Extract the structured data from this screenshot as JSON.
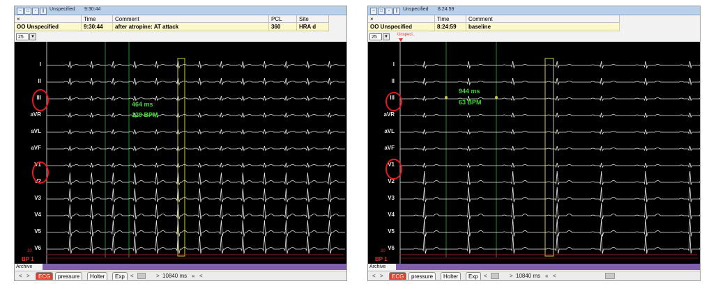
{
  "colors": {
    "ecg_trace": "#e8e8e8",
    "grid_green": "#2a8a2a",
    "yellow_box": "#cfcf4a",
    "circle": "#e01b1b",
    "bp_red": "#cc2a2a",
    "purple": "#7f5fae"
  },
  "panels": [
    {
      "title_time": "9:30:44",
      "title_label": "Unspecified",
      "columns": {
        "time": "Time",
        "comment": "Comment",
        "pcl": "PCL",
        "site": "Site",
        "close": "×"
      },
      "row": {
        "name": "OO Unspecified",
        "time": "9:30:44",
        "comment": "after atropine: AT attack",
        "pcl": "360",
        "site": "HRA d"
      },
      "zoom": "25",
      "measure_ms": "464 ms",
      "measure_bpm": "129 BPM",
      "leads": [
        "I",
        "II",
        "III",
        "aVR",
        "aVL",
        "aVF",
        "V1",
        "V2",
        "V3",
        "V4",
        "V5",
        "V6"
      ],
      "bp_label": "BP 1",
      "bp_small": "20",
      "archive_label": "Archive",
      "tabs": [
        "ECG",
        "pressure",
        "Holter",
        "Exp"
      ],
      "scale": "10840 ms",
      "nav_left": "<",
      "nav_right": ">",
      "nav_rewind": "«",
      "nav_prev": "<",
      "nav_next": ">",
      "heart_rate_bpm": 129
    },
    {
      "title_time": "8:24:59",
      "title_label": "Unspecified",
      "columns": {
        "time": "Time",
        "comment": "Comment",
        "close": "×"
      },
      "row": {
        "name": "OO Unspecified",
        "time": "8:24:59",
        "comment": "baseline"
      },
      "zoom": "25",
      "marker_text": "Unspeci..",
      "measure_ms": "944 ms",
      "measure_bpm": "63 BPM",
      "leads": [
        "I",
        "II",
        "III",
        "aVR",
        "aVL",
        "aVF",
        "V1",
        "V2",
        "V3",
        "V4",
        "V5",
        "V6"
      ],
      "bp_label": "BP 1",
      "bp_small": "20",
      "archive_label": "Archive",
      "tabs": [
        "ECG",
        "pressure",
        "Holter",
        "Exp"
      ],
      "scale": "10840 ms",
      "nav_left": "<",
      "nav_right": ">",
      "nav_rewind": "«",
      "nav_prev": "<",
      "nav_next": ">",
      "heart_rate_bpm": 63
    }
  ]
}
